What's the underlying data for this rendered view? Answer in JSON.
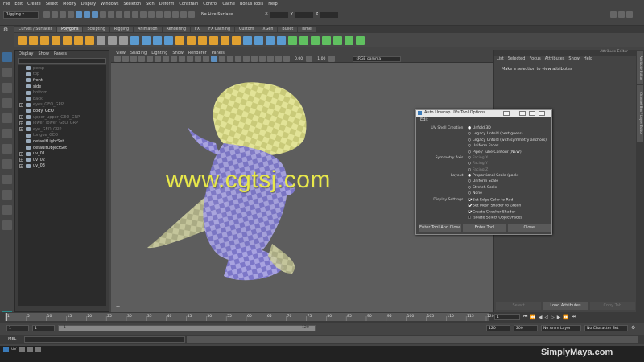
{
  "menubar": [
    "File",
    "Edit",
    "Create",
    "Select",
    "Modify",
    "Display",
    "Windows",
    "Skeleton",
    "Skin",
    "Deform",
    "Constrain",
    "Control",
    "Cache",
    "Bonus Tools",
    "Help"
  ],
  "status": {
    "mode": "Rigging",
    "live_surface": "No Live Surface",
    "x_label": "X",
    "y_label": "Y",
    "z_label": "Z"
  },
  "shelf_tabs": [
    "Curves / Surfaces",
    "Polygons",
    "Sculpting",
    "Rigging",
    "Animation",
    "Rendering",
    "FX",
    "FX Caching",
    "Custom",
    "XGen",
    "Bullet",
    "Isme"
  ],
  "shelf_active": "Polygons",
  "outliner": {
    "menu": [
      "Display",
      "Show",
      "Panels"
    ],
    "items": [
      {
        "label": "persp",
        "dim": true,
        "expand": ""
      },
      {
        "label": "top",
        "dim": true,
        "expand": ""
      },
      {
        "label": "front",
        "dim": false,
        "expand": ""
      },
      {
        "label": "side",
        "dim": false,
        "expand": ""
      },
      {
        "label": "bottom",
        "dim": true,
        "expand": ""
      },
      {
        "label": "back",
        "dim": true,
        "expand": ""
      },
      {
        "label": "eyes_GEO_GRP",
        "dim": true,
        "expand": "+"
      },
      {
        "label": "body_GEO",
        "dim": false,
        "expand": ""
      },
      {
        "label": "upper_upper_GEO_GRP",
        "dim": true,
        "expand": "+"
      },
      {
        "label": "lower_lower_GEO_GRP",
        "dim": true,
        "expand": "+"
      },
      {
        "label": "eye_GEO_GRP",
        "dim": true,
        "expand": "+"
      },
      {
        "label": "tongue_GEO",
        "dim": true,
        "expand": ""
      },
      {
        "label": "defaultLightSet",
        "dim": false,
        "expand": ""
      },
      {
        "label": "defaultObjectSet",
        "dim": false,
        "expand": ""
      },
      {
        "label": "uv_01",
        "dim": false,
        "expand": "+"
      },
      {
        "label": "uv_02",
        "dim": false,
        "expand": "+"
      },
      {
        "label": "uv_03",
        "dim": false,
        "expand": "+"
      }
    ]
  },
  "viewport": {
    "menu": [
      "View",
      "Shading",
      "Lighting",
      "Show",
      "Renderer",
      "Panels"
    ],
    "value_a": "0.00",
    "value_b": "1.00",
    "gamma": "sRGB gamma"
  },
  "attribute_editor": {
    "title": "Attribute Editor",
    "menu": [
      "List",
      "Selected",
      "Focus",
      "Attributes",
      "Show",
      "Help"
    ],
    "message": "Make a selection to view attributes",
    "buttons": [
      "Select",
      "Load Attributes",
      "Copy Tab"
    ],
    "side_tabs": [
      "Attribute Editor",
      "Channel Box / Layer Editor"
    ]
  },
  "dialog": {
    "title": "Auto Unwrap UVs Tool Options",
    "edit": "Edit",
    "labels": {
      "shell": "UV Shell Creation:",
      "symmetry": "Symmetry Axis:",
      "layout": "Layout:",
      "display": "Display Settings:"
    },
    "shell_options": [
      {
        "label": "Unfold 3D",
        "on": true
      },
      {
        "label": "Legacy Unfold  (best guess)",
        "on": false
      },
      {
        "label": "Legacy Unfold  (with symmetry anchors)",
        "on": false
      },
      {
        "label": "Uniform Faces",
        "on": false
      },
      {
        "label": "Pipe / Tube Contour (NEW)",
        "on": false
      }
    ],
    "symmetry_options": [
      {
        "label": "Facing X",
        "on": false
      },
      {
        "label": "Facing Y",
        "on": false
      },
      {
        "label": "Facing Z",
        "on": false
      }
    ],
    "layout_options": [
      {
        "label": "Proportional Scale (pack)",
        "on": true
      },
      {
        "label": "Uniform Scale",
        "on": false
      },
      {
        "label": "Stretch Scale",
        "on": false
      },
      {
        "label": "None",
        "on": false
      }
    ],
    "display_options": [
      {
        "label": "Set Edge Color to Red",
        "on": true
      },
      {
        "label": "Set Mesh Shader to Green",
        "on": true
      },
      {
        "label": "Create Checker Shader",
        "on": true
      },
      {
        "label": "Isolate Select Object/Faces",
        "on": false
      }
    ],
    "buttons": [
      "Enter Tool And Close",
      "Enter Tool",
      "Close"
    ]
  },
  "timeline": {
    "ticks": [
      "1",
      "5",
      "10",
      "15",
      "20",
      "25",
      "30",
      "35",
      "40",
      "45",
      "50",
      "55",
      "60",
      "65",
      "70",
      "75",
      "80",
      "85",
      "90",
      "95",
      "100",
      "105",
      "110",
      "115",
      "120"
    ],
    "current_frame": "1"
  },
  "range": {
    "start": "1",
    "inner_start": "1",
    "range_start_mark": "1",
    "range_end_mark": "120",
    "end": "120",
    "anim_end": "200",
    "anim_layer": "No Anim Layer",
    "char_set": "No Character Set"
  },
  "command_line": {
    "label": "MEL"
  },
  "taskbar": {
    "tab": "UV"
  },
  "watermark": "www.cgtsj.com",
  "brand": "SimplyMaya.com"
}
